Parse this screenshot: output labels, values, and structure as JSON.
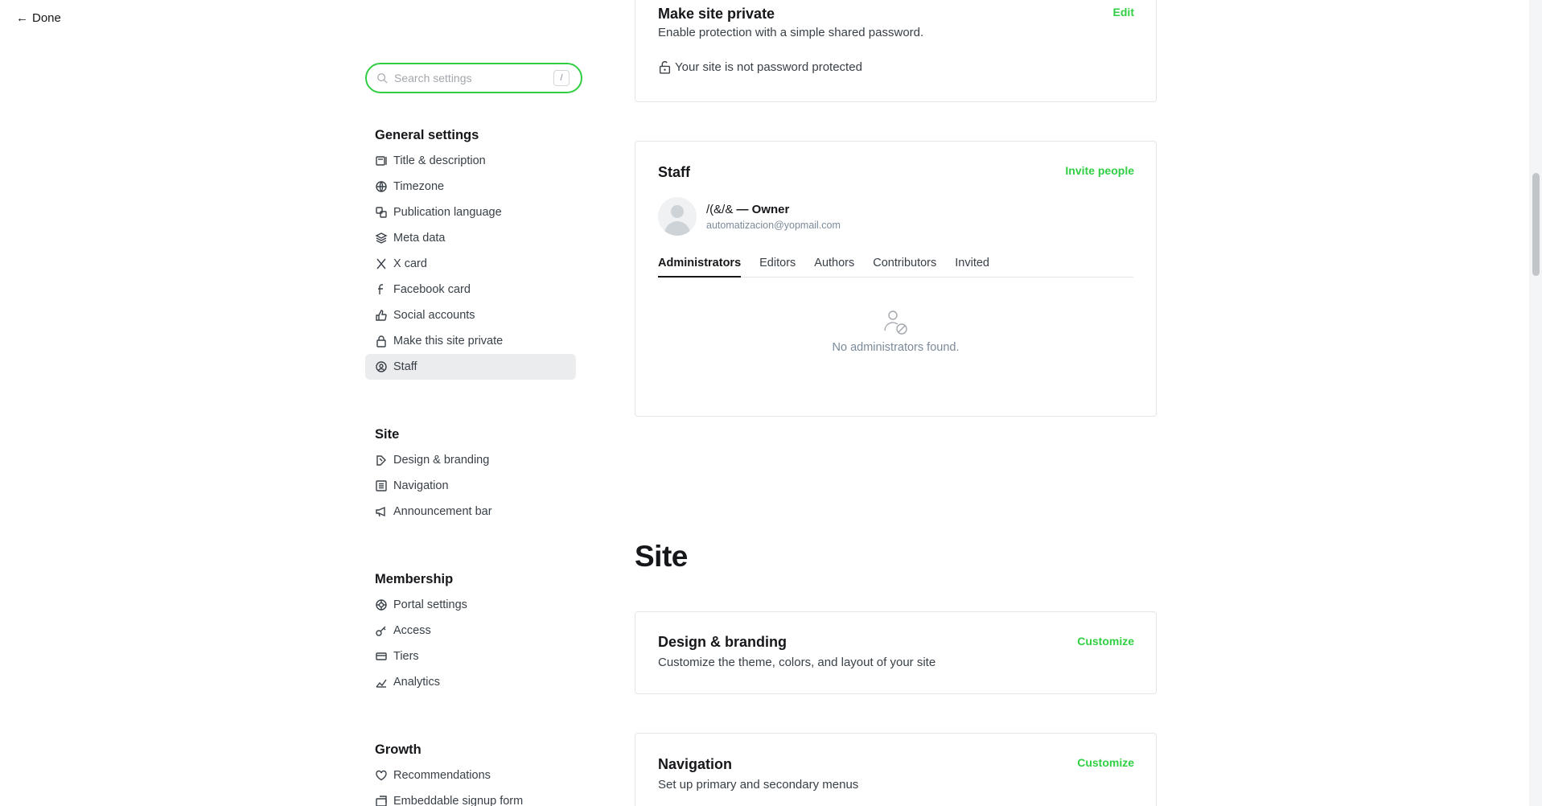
{
  "header": {
    "done_label": "Done"
  },
  "search": {
    "placeholder": "Search settings",
    "shortcut": "/"
  },
  "sidebar": {
    "groups": [
      {
        "title": "General settings",
        "items": [
          {
            "label": "Title & description",
            "icon": "title-icon"
          },
          {
            "label": "Timezone",
            "icon": "globe-icon"
          },
          {
            "label": "Publication language",
            "icon": "language-icon"
          },
          {
            "label": "Meta data",
            "icon": "layers-icon"
          },
          {
            "label": "X card",
            "icon": "x-logo-icon"
          },
          {
            "label": "Facebook card",
            "icon": "facebook-icon"
          },
          {
            "label": "Social accounts",
            "icon": "thumbs-up-icon"
          },
          {
            "label": "Make this site private",
            "icon": "lock-icon"
          },
          {
            "label": "Staff",
            "icon": "staff-icon",
            "active": true
          }
        ]
      },
      {
        "title": "Site",
        "items": [
          {
            "label": "Design & branding",
            "icon": "brush-icon"
          },
          {
            "label": "Navigation",
            "icon": "list-icon"
          },
          {
            "label": "Announcement bar",
            "icon": "megaphone-icon"
          }
        ]
      },
      {
        "title": "Membership",
        "items": [
          {
            "label": "Portal settings",
            "icon": "portal-icon"
          },
          {
            "label": "Access",
            "icon": "key-icon"
          },
          {
            "label": "Tiers",
            "icon": "tiers-icon"
          },
          {
            "label": "Analytics",
            "icon": "chart-icon"
          }
        ]
      },
      {
        "title": "Growth",
        "items": [
          {
            "label": "Recommendations",
            "icon": "heart-icon"
          },
          {
            "label": "Embeddable signup form",
            "icon": "embed-icon"
          }
        ]
      }
    ]
  },
  "private_card": {
    "title": "Make site private",
    "description": "Enable protection with a simple shared password.",
    "action": "Edit",
    "status": "Your site is not password protected"
  },
  "staff_card": {
    "title": "Staff",
    "action": "Invite people",
    "owner_name": "/(&/&",
    "owner_role": "— Owner",
    "owner_email": "automatizacion@yopmail.com",
    "tabs": [
      "Administrators",
      "Editors",
      "Authors",
      "Contributors",
      "Invited"
    ],
    "active_tab": "Administrators",
    "empty_message": "No administrators found."
  },
  "site_section": {
    "heading": "Site"
  },
  "design_card": {
    "title": "Design & branding",
    "description": "Customize the theme, colors, and layout of your site",
    "action": "Customize"
  },
  "navigation_card": {
    "title": "Navigation",
    "description": "Set up primary and secondary menus",
    "action": "Customize"
  },
  "colors": {
    "accent": "#30cf43",
    "text": "#15171a",
    "muted": "#394047"
  }
}
